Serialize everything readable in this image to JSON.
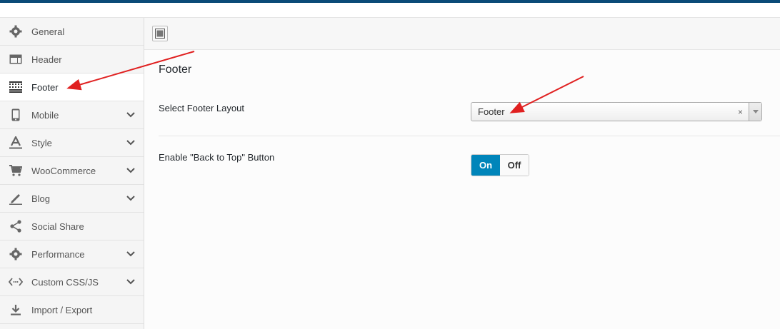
{
  "sidebar": {
    "items": [
      {
        "label": "General"
      },
      {
        "label": "Header"
      },
      {
        "label": "Footer"
      },
      {
        "label": "Mobile"
      },
      {
        "label": "Style"
      },
      {
        "label": "WooCommerce"
      },
      {
        "label": "Blog"
      },
      {
        "label": "Social Share"
      },
      {
        "label": "Performance"
      },
      {
        "label": "Custom CSS/JS"
      },
      {
        "label": "Import / Export"
      }
    ]
  },
  "main": {
    "section_title": "Footer",
    "footer_layout": {
      "label": "Select Footer Layout",
      "value": "Footer",
      "clear": "×"
    },
    "back_to_top": {
      "label": "Enable \"Back to Top\" Button",
      "on_label": "On",
      "off_label": "Off"
    }
  },
  "colors": {
    "accent": "#0085ba",
    "top_bar": "#0a4b78",
    "annotation_arrow": "#e02020"
  }
}
